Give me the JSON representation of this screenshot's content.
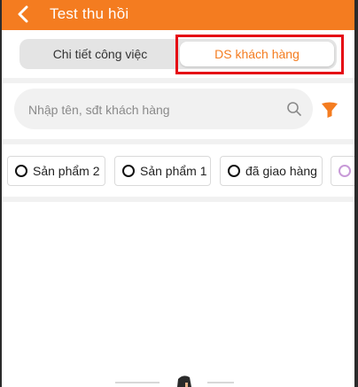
{
  "header": {
    "title": "Test thu hồi",
    "back_icon": "chevron-left-icon",
    "background": "#f47c20"
  },
  "tabs": [
    {
      "label": "Chi tiết công việc",
      "selected": false
    },
    {
      "label": "DS khách hàng",
      "selected": true
    }
  ],
  "search": {
    "placeholder": "Nhập tên, sđt khách hàng",
    "value": "",
    "icon": "search-icon"
  },
  "filter": {
    "icon": "filter-icon",
    "color": "#f47c20"
  },
  "chips": [
    {
      "label": "Sản phẩm 2"
    },
    {
      "label": "Sản phẩm 1"
    },
    {
      "label": "đã giao hàng"
    },
    {
      "label": ""
    }
  ],
  "colors": {
    "accent": "#f47c20",
    "highlight_box": "#e50914"
  }
}
